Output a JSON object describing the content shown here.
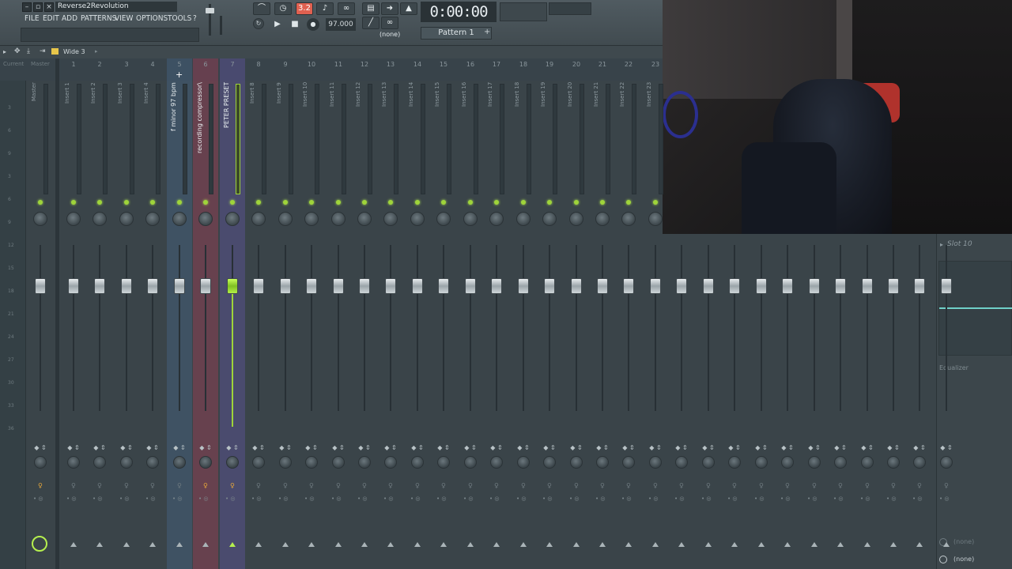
{
  "window": {
    "title": "Reverse2Revolution"
  },
  "menu": [
    "FILE",
    "EDIT",
    "ADD",
    "PATTERNS",
    "VIEW",
    "OPTIONS",
    "TOOLS",
    "?"
  ],
  "transport": {
    "song_position": "0:00:00",
    "tempo": "97.000",
    "pattern": "Pattern 1",
    "pattern_none": "(none)",
    "counter_label": "3.2"
  },
  "mixer": {
    "title": "Wide 3",
    "left_labels": [
      "Current",
      "Master"
    ],
    "channel_numbers": [
      "1",
      "2",
      "3",
      "4",
      "5",
      "6",
      "7",
      "8",
      "9",
      "10",
      "11",
      "12",
      "13",
      "14",
      "15",
      "16",
      "17",
      "18",
      "19",
      "20",
      "21",
      "22",
      "23"
    ],
    "strips": [
      {
        "num": "M",
        "name": "Master",
        "tint": "",
        "fader": 0.78,
        "active": false,
        "send": true
      },
      {
        "num": "1",
        "name": "Insert 1",
        "tint": "",
        "fader": 0.78,
        "active": false,
        "send": false
      },
      {
        "num": "2",
        "name": "Insert 2",
        "tint": "",
        "fader": 0.78,
        "active": false,
        "send": false
      },
      {
        "num": "3",
        "name": "Insert 3",
        "tint": "",
        "fader": 0.78,
        "active": false,
        "send": false
      },
      {
        "num": "4",
        "name": "Insert 4",
        "tint": "",
        "fader": 0.78,
        "active": false,
        "send": false
      },
      {
        "num": "5",
        "name": "f minor 97 bpm",
        "tint": "blue",
        "fader": 0.78,
        "active": false,
        "send": false
      },
      {
        "num": "6",
        "name": "recording compressor\\",
        "tint": "red",
        "fader": 0.78,
        "active": false,
        "send": true
      },
      {
        "num": "7",
        "name": "PETER PRESET",
        "tint": "purple",
        "fader": 0.78,
        "active": true,
        "send": true
      },
      {
        "num": "8",
        "name": "Insert 8",
        "tint": "",
        "fader": 0.78,
        "active": false,
        "send": false
      },
      {
        "num": "9",
        "name": "Insert 9",
        "tint": "",
        "fader": 0.78,
        "active": false,
        "send": false
      },
      {
        "num": "10",
        "name": "Insert 10",
        "tint": "",
        "fader": 0.78,
        "active": false,
        "send": false
      },
      {
        "num": "11",
        "name": "Insert 11",
        "tint": "",
        "fader": 0.78,
        "active": false,
        "send": false
      },
      {
        "num": "12",
        "name": "Insert 12",
        "tint": "",
        "fader": 0.78,
        "active": false,
        "send": false
      },
      {
        "num": "13",
        "name": "Insert 13",
        "tint": "",
        "fader": 0.78,
        "active": false,
        "send": false
      },
      {
        "num": "14",
        "name": "Insert 14",
        "tint": "",
        "fader": 0.78,
        "active": false,
        "send": false
      },
      {
        "num": "15",
        "name": "Insert 15",
        "tint": "",
        "fader": 0.78,
        "active": false,
        "send": false
      },
      {
        "num": "16",
        "name": "Insert 16",
        "tint": "",
        "fader": 0.78,
        "active": false,
        "send": false
      },
      {
        "num": "17",
        "name": "Insert 17",
        "tint": "",
        "fader": 0.78,
        "active": false,
        "send": false
      },
      {
        "num": "18",
        "name": "Insert 18",
        "tint": "",
        "fader": 0.78,
        "active": false,
        "send": false
      },
      {
        "num": "19",
        "name": "Insert 19",
        "tint": "",
        "fader": 0.78,
        "active": false,
        "send": false
      },
      {
        "num": "20",
        "name": "Insert 20",
        "tint": "",
        "fader": 0.78,
        "active": false,
        "send": false
      },
      {
        "num": "21",
        "name": "Insert 21",
        "tint": "",
        "fader": 0.78,
        "active": false,
        "send": false
      },
      {
        "num": "22",
        "name": "Insert 22",
        "tint": "",
        "fader": 0.78,
        "active": false,
        "send": false
      },
      {
        "num": "23",
        "name": "Insert 23",
        "tint": "",
        "fader": 0.78,
        "active": false,
        "send": false
      }
    ],
    "extra_strips": 11
  },
  "fx_panel": {
    "slot_label": "Slot 10",
    "plugin_label": "Equalizer",
    "slot_none": "(none)",
    "output_none": "(none)"
  },
  "colors": {
    "accent_green": "#9fd43a",
    "tint_blue": "#5082be",
    "tint_red": "#be3c5a",
    "tint_purple": "#6e5abe"
  }
}
